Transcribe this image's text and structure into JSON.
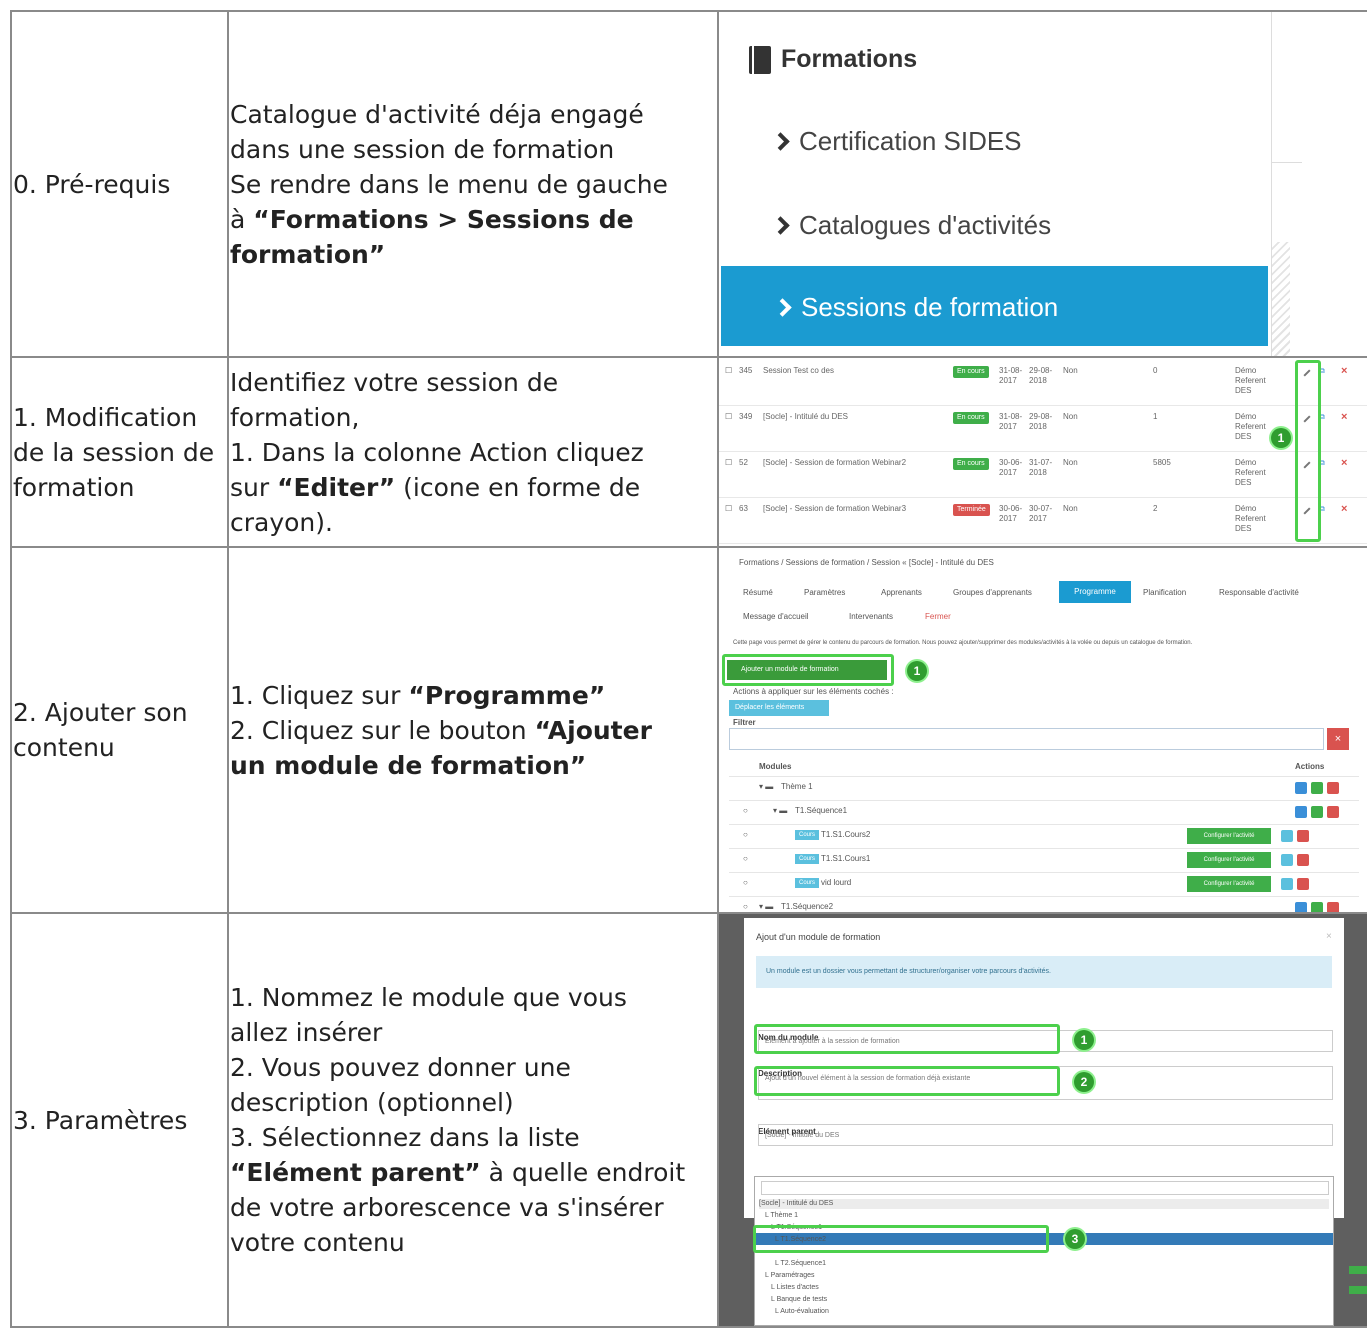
{
  "rows": [
    {
      "step": "0. Pré-requis",
      "lines": [
        {
          "pre": "Catalogue d'activité déja engagé",
          "bold": "",
          "post": ""
        },
        {
          "pre": "dans une session de formation",
          "bold": "",
          "post": ""
        },
        {
          "pre": "Se rendre dans le menu de gauche",
          "bold": "",
          "post": ""
        },
        {
          "pre": "à ",
          "bold": "“Formations > Sessions de",
          "post": ""
        },
        {
          "pre": "",
          "bold": "formation”",
          "post": ""
        }
      ]
    },
    {
      "step": "1. Modification de la session de formation",
      "lines": [
        {
          "pre": "Identifiez votre session de",
          "bold": "",
          "post": ""
        },
        {
          "pre": "formation,",
          "bold": "",
          "post": ""
        },
        {
          "pre": "1. Dans la colonne Action cliquez",
          "bold": "",
          "post": ""
        },
        {
          "pre": "sur ",
          "bold": "“Editer”",
          "post": " (icone en forme de"
        },
        {
          "pre": "crayon).",
          "bold": "",
          "post": ""
        }
      ]
    },
    {
      "step": "2. Ajouter son contenu",
      "lines": [
        {
          "pre": "1. Cliquez sur ",
          "bold": "“Programme”",
          "post": ""
        },
        {
          "pre": "2. Cliquez sur le bouton ",
          "bold": "“Ajouter",
          "post": ""
        },
        {
          "pre": "",
          "bold": "un module de formation”",
          "post": ""
        }
      ]
    },
    {
      "step": "3. Paramètres",
      "lines": [
        {
          "pre": "1. Nommez le module que vous",
          "bold": "",
          "post": ""
        },
        {
          "pre": "allez insérer",
          "bold": "",
          "post": ""
        },
        {
          "pre": "2. Vous pouvez donner une",
          "bold": "",
          "post": ""
        },
        {
          "pre": "description (optionnel)",
          "bold": "",
          "post": ""
        },
        {
          "pre": "3. Sélectionnez dans la liste",
          "bold": "",
          "post": ""
        },
        {
          "pre": "",
          "bold": "“Elément parent”",
          "post": " à quelle endroit"
        },
        {
          "pre": "de votre arborescence va s'insérer",
          "bold": "",
          "post": ""
        },
        {
          "pre": "votre contenu",
          "bold": "",
          "post": ""
        }
      ]
    }
  ],
  "shot_menu": {
    "title": "Formations",
    "items": [
      "Certification SIDES",
      "Catalogues d'activités",
      "Sessions de formation"
    ],
    "active_color": "#1b9bd1"
  },
  "shot_sessions": {
    "rows": [
      {
        "id": "345",
        "name": "Session Test co des",
        "status": "En cours",
        "status_color": "green",
        "start": "31-08-2017",
        "end": "29-08-2018",
        "flag": "Non",
        "count": "0",
        "ref": "Démo Referent DES"
      },
      {
        "id": "349",
        "name": "[Socle] - Intitulé du DES",
        "status": "En cours",
        "status_color": "green",
        "start": "31-08-2017",
        "end": "29-08-2018",
        "flag": "Non",
        "count": "1",
        "ref": "Démo Referent DES"
      },
      {
        "id": "52",
        "name": "[Socle] - Session de formation Webinar2",
        "status": "En cours",
        "status_color": "green",
        "start": "30-06-2017",
        "end": "31-07-2018",
        "flag": "Non",
        "count": "5805",
        "ref": "Démo Referent DES"
      },
      {
        "id": "63",
        "name": "[Socle] - Session de formation Webinar3",
        "status": "Terminée",
        "status_color": "red",
        "start": "30-06-2017",
        "end": "30-07-2017",
        "flag": "Non",
        "count": "2",
        "ref": "Démo Referent DES"
      }
    ],
    "marker": "1"
  },
  "shot_programme": {
    "breadcrumb": "Formations / Sessions de formation / Session « [Socle] - Intitulé du DES",
    "tabs": [
      "Résumé",
      "Paramètres",
      "Apprenants",
      "Groupes d'apprenants",
      "Programme",
      "Planification",
      "Responsable d'activité"
    ],
    "tabs2": [
      "Message d'accueil",
      "Intervenants",
      "Fermer"
    ],
    "info": "Cette page vous permet de gérer le contenu du parcours de formation. Nous pouvez ajouter/supprimer des modules/activités à la volée ou depuis un catalogue de formation.",
    "add_button": "Ajouter un module de formation",
    "actions_label": "Actions à appliquer sur les éléments cochés :",
    "move_button": "Déplacer les éléments",
    "filter_label": "Filtrer",
    "col_modules": "Modules",
    "col_actions": "Actions",
    "tree": [
      "Thème 1",
      "T1.Séquence1",
      "T1.S1.Cours2",
      "T1.S1.Cours1",
      "vid lourd",
      "T1.Séquence2"
    ],
    "cours_tag": "Cours",
    "config_button": "Configurer l'activité",
    "marker": "1"
  },
  "shot_modal": {
    "title": "Ajout d'un module de formation",
    "alert": "Un module est un dossier vous permettant de structurer/organiser votre parcours d'activités.",
    "name_label": "Nom du module",
    "name_value": "Elément à ajouter à la session de formation",
    "desc_label": "Description",
    "desc_value": "Ajout d'un nouvel élément à la session de formation déjà existante",
    "parent_label": "Elément parent",
    "parent_value": "[Socle] - Intitulé du DES",
    "options": [
      "[Socle] - Intitulé du DES",
      "L Thème 1",
      "L T1.Séquence1",
      "L T1.Séquence2",
      "L Thème2",
      "L T2.Séquence1",
      "L Paramétrages",
      "L Listes d'actes",
      "L Banque de tests",
      "L Auto-évaluation"
    ],
    "markers": [
      "1",
      "2",
      "3"
    ]
  }
}
